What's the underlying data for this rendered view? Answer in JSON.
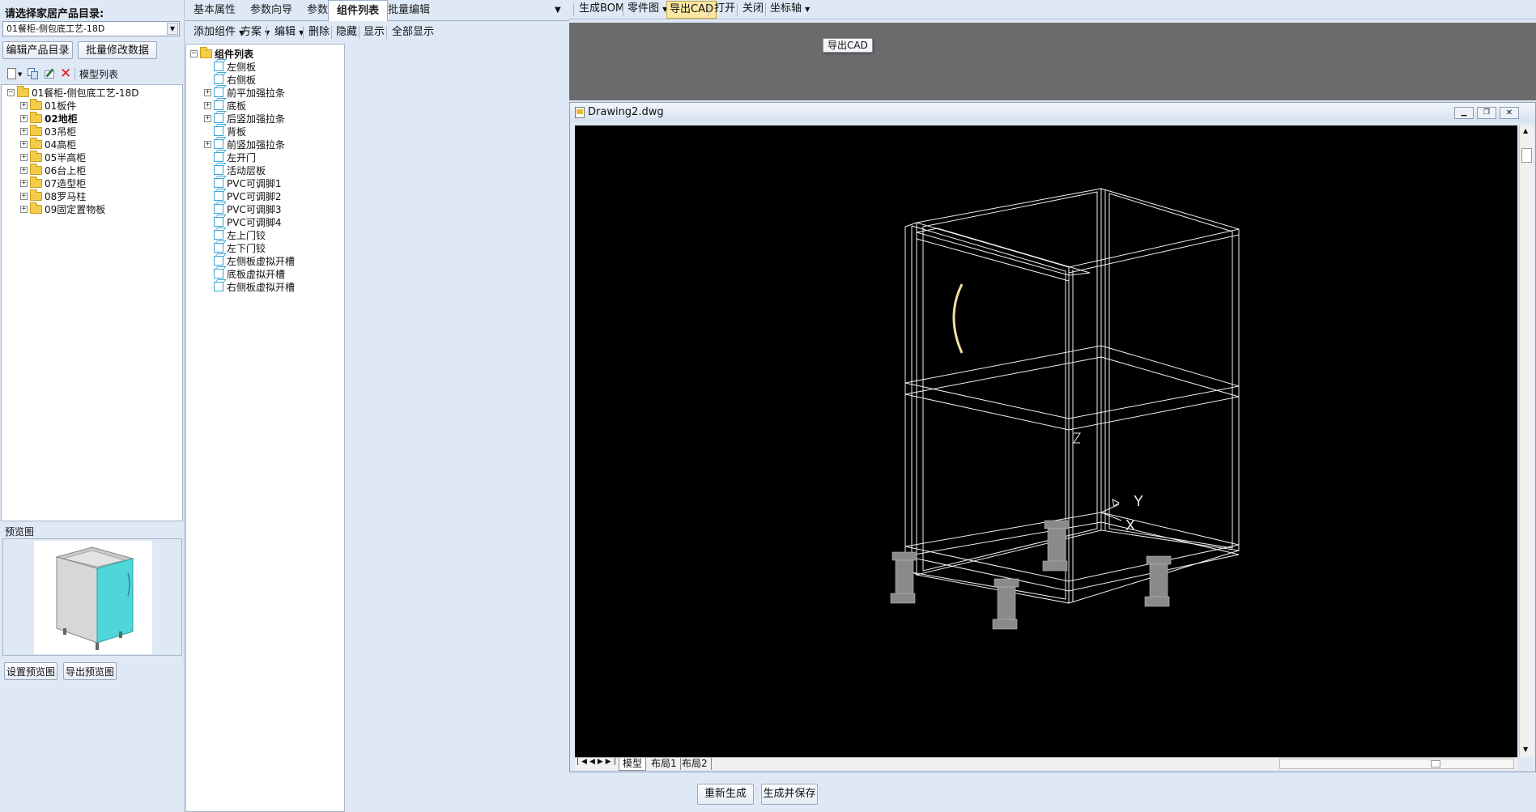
{
  "left_panel": {
    "catalog_label": "请选择家居产品目录:",
    "catalog_select_value": "01餐柜-侧包底工艺-18D",
    "edit_catalog_button": "编辑产品目录",
    "batch_modify_button": "批量修改数据",
    "model_list_label": "模型列表",
    "tree": {
      "root": "01餐柜-侧包底工艺-18D",
      "children": [
        "01板件",
        "02地柜",
        "03吊柜",
        "04高柜",
        "05半高柜",
        "06台上柜",
        "07造型柜",
        "08罗马柱",
        "09固定置物板"
      ],
      "selected": "02地柜"
    },
    "preview_label": "预览图",
    "set_preview_button": "设置预览图",
    "export_preview_button": "导出预览图"
  },
  "middle_panel": {
    "tabs": [
      "基本属性",
      "参数向导",
      "参数列表",
      "组件列表",
      "批量编辑"
    ],
    "active_tab": "组件列表",
    "toolbar": {
      "add_component": "添加组件",
      "scheme": "方案",
      "edit": "编辑",
      "delete": "删除",
      "hide": "隐藏",
      "show": "显示",
      "show_all": "全部显示"
    },
    "tree": {
      "root": "组件列表",
      "items": [
        {
          "label": "左侧板",
          "expandable": false
        },
        {
          "label": "右侧板",
          "expandable": false
        },
        {
          "label": "前平加强拉条",
          "expandable": true
        },
        {
          "label": "底板",
          "expandable": true
        },
        {
          "label": "后竖加强拉条",
          "expandable": true
        },
        {
          "label": "背板",
          "expandable": false
        },
        {
          "label": "前竖加强拉条",
          "expandable": true
        },
        {
          "label": "左开门",
          "expandable": false
        },
        {
          "label": "活动层板",
          "expandable": false
        },
        {
          "label": "PVC可调脚1",
          "expandable": false
        },
        {
          "label": "PVC可调脚2",
          "expandable": false
        },
        {
          "label": "PVC可调脚3",
          "expandable": false
        },
        {
          "label": "PVC可调脚4",
          "expandable": false
        },
        {
          "label": "左上门铰",
          "expandable": false
        },
        {
          "label": "左下门铰",
          "expandable": false
        },
        {
          "label": "左侧板虚拟开槽",
          "expandable": false
        },
        {
          "label": "底板虚拟开槽",
          "expandable": false
        },
        {
          "label": "右侧板虚拟开槽",
          "expandable": false
        }
      ]
    }
  },
  "right_panel": {
    "toolbar": {
      "generate_bom": "生成BOM",
      "parts_drawing": "零件图",
      "export_cad": "导出CAD",
      "open": "打开",
      "close": "关闭",
      "axis": "坐标轴"
    },
    "tooltip": "导出CAD",
    "drawing_window": {
      "title": "Drawing2.dwg",
      "layout_tabs": [
        "模型",
        "布局1",
        "布局2"
      ],
      "axis_labels": {
        "y": "Y",
        "x": "X",
        "z": "Z"
      }
    },
    "regenerate_button": "重新生成",
    "generate_save_button": "生成并保存"
  },
  "colors": {
    "panel_bg": "#dfe8f5",
    "tree_bg": "#ffffff",
    "cad_bg": "#000000",
    "dark_area": "#6b6b6b",
    "preview_door": "#4fd6d9"
  }
}
